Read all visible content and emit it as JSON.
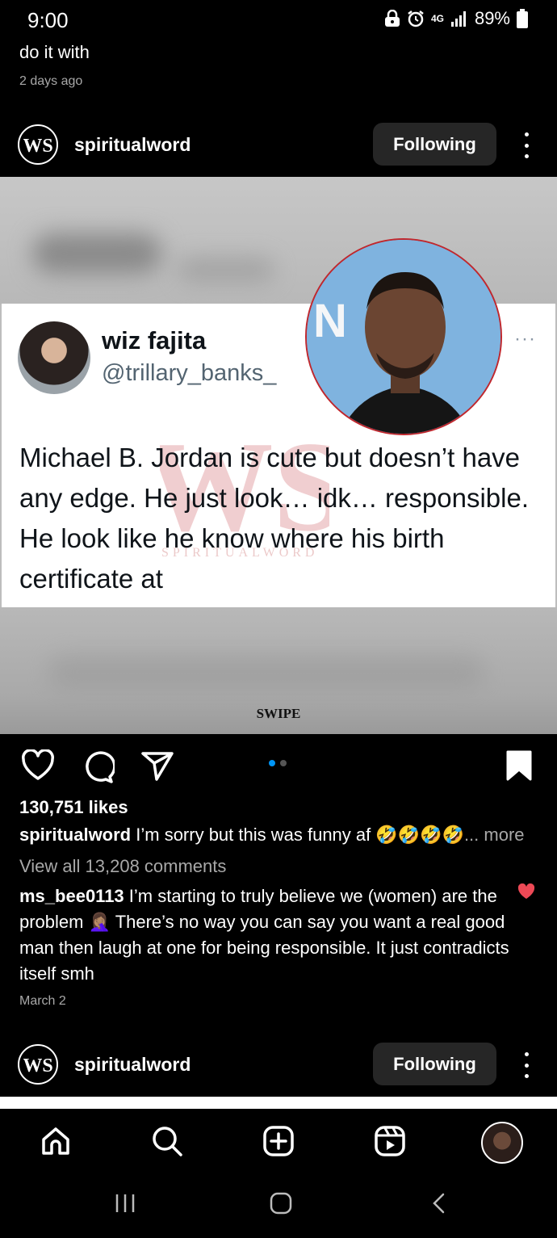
{
  "status_bar": {
    "time": "9:00",
    "network": "4G",
    "battery": "89%",
    "icons": [
      "lock-icon",
      "alarm-icon",
      "signal-icon",
      "battery-icon"
    ]
  },
  "previous_post": {
    "caption_tail": "do it with",
    "date": "2 days ago"
  },
  "post": {
    "username": "spiritualword",
    "follow_label": "Following",
    "image": {
      "tweet": {
        "name": "wiz fajita",
        "handle": "@trillary_banks_",
        "dots": "···",
        "text": "Michael B. Jordan is cute but doesn’t have any edge. He just look… idk… responsible. He look like he know where his birth certificate at"
      },
      "watermark_text": "SPIRITUALWORD",
      "swipe_label": "SWIPE"
    },
    "likes": "130,751 likes",
    "caption": {
      "username": "spiritualword",
      "text": "I’m sorry but this was funny af 🤣🤣🤣🤣",
      "more": "... more"
    },
    "view_comments": "View all 13,208 comments",
    "top_comment": {
      "username": "ms_bee0113",
      "text": "I’m starting to truly believe we (women) are the problem 🤦🏽‍♀️ There’s no way you can say you want a real good man then laugh at one for being responsible. It just contradicts itself smh"
    },
    "date": "March 2"
  },
  "next_post": {
    "username": "spiritualword",
    "follow_label": "Following"
  },
  "carousel": {
    "count": 2,
    "active": 0
  },
  "colors": {
    "accent": "#0095f6",
    "like_red": "#ed4956",
    "button_bg": "#262626"
  },
  "bottom_nav": [
    "home-icon",
    "search-icon",
    "create-icon",
    "reels-icon",
    "profile-avatar"
  ]
}
